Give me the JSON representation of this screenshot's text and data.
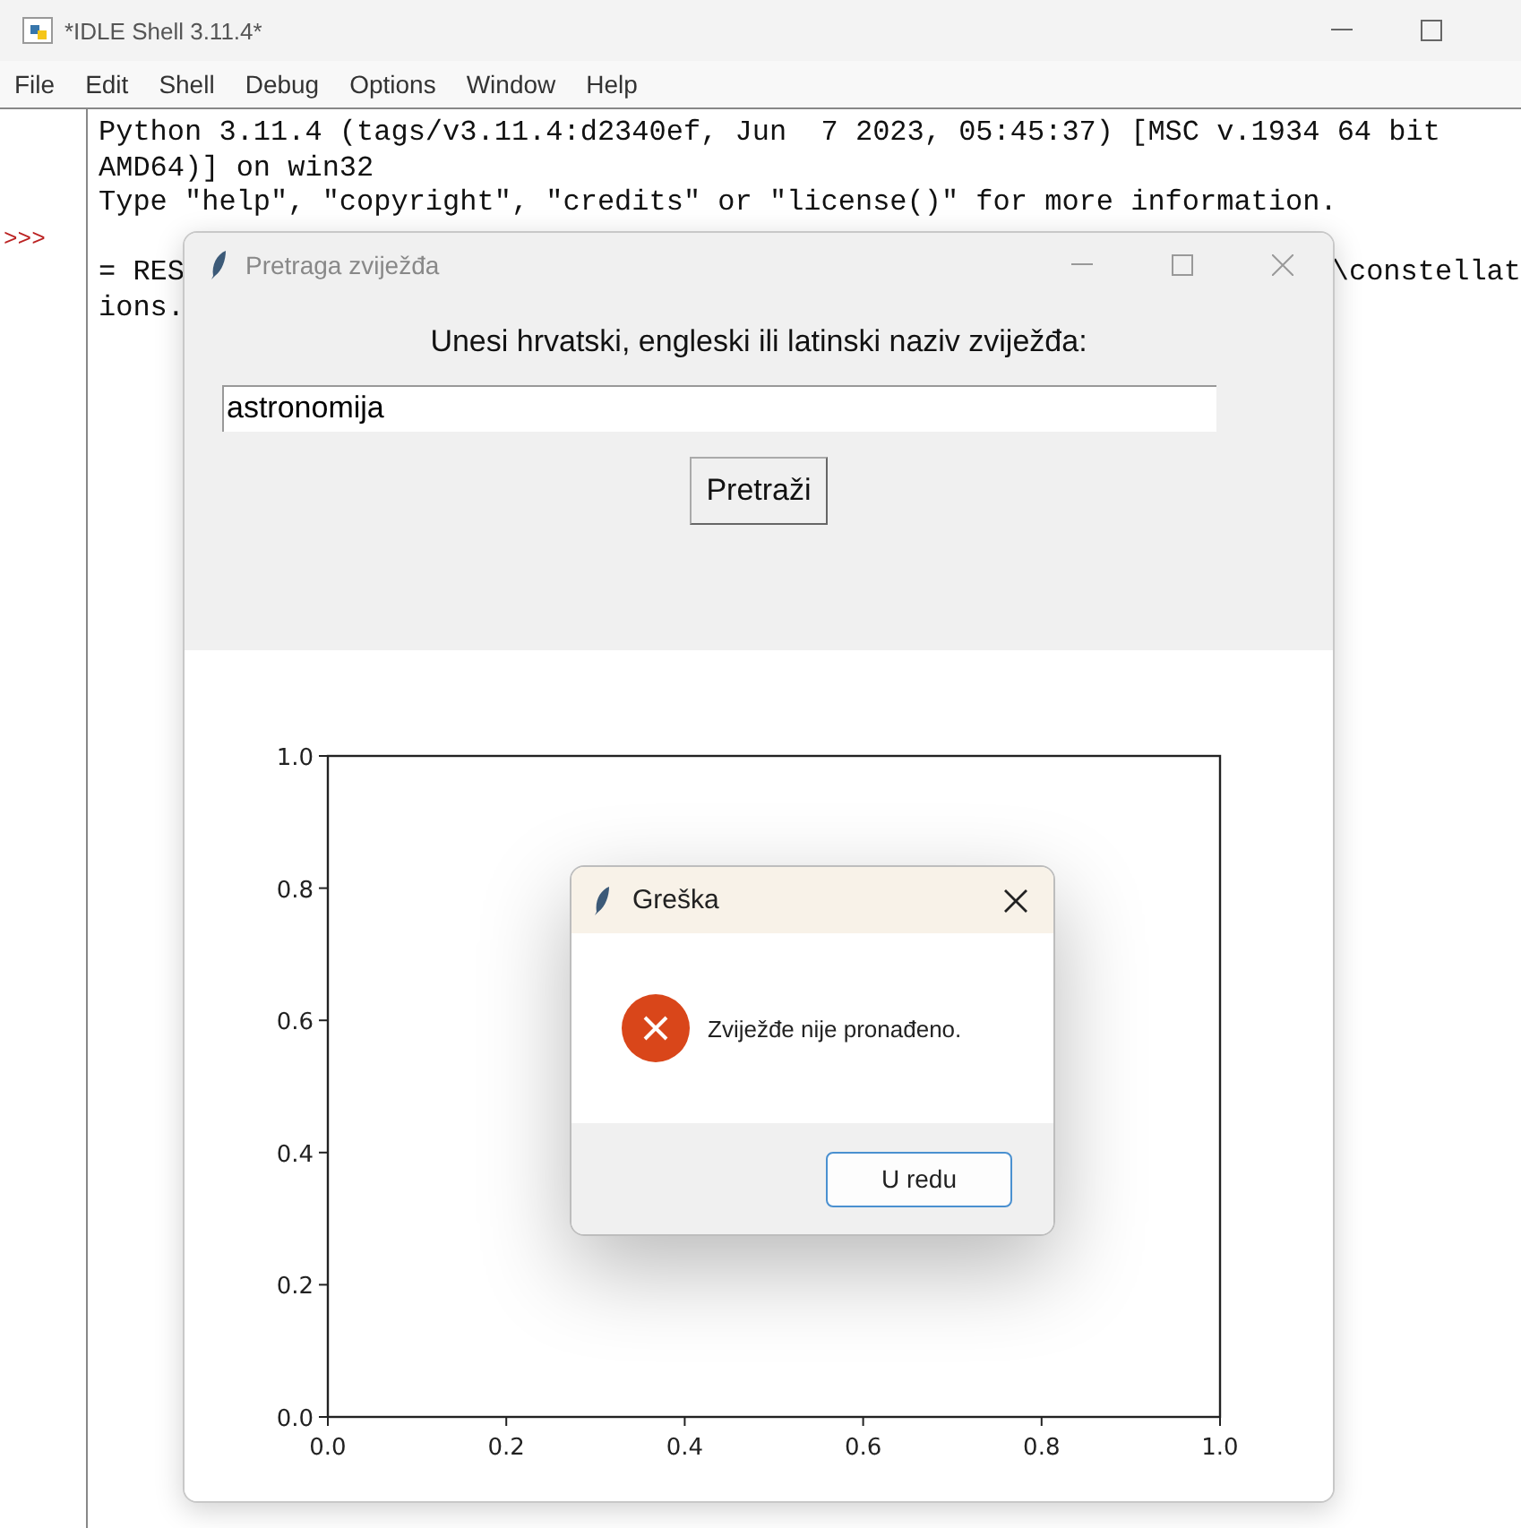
{
  "window": {
    "title": "*IDLE Shell 3.11.4*"
  },
  "menu": [
    "File",
    "Edit",
    "Shell",
    "Debug",
    "Options",
    "Window",
    "Help"
  ],
  "shell": {
    "rows": [
      {
        "text": "Python 3.11.4 (tags/v3.11.4:d2340ef, Jun  7 2023, 05:45:37) [MSC v.1934 64 bit"
      },
      {
        "text": "AMD64)] on win32"
      },
      {
        "text": "Type \"help\", \"copyright\", \"credits\" or \"license()\" for more information."
      },
      {
        "prompt": ">>>"
      },
      {
        "text": "= RES",
        "text_right": "\\constellat"
      },
      {
        "text": "ions."
      }
    ]
  },
  "search_window": {
    "title": "Pretraga zviježđa",
    "prompt": "Unesi hrvatski, engleski ili latinski naziv zviježđa:",
    "entry": {
      "value": "astronomija"
    },
    "button": "Pretraži",
    "chart_data": {
      "type": "line",
      "xlim": [
        0,
        1
      ],
      "ylim": [
        0,
        1
      ],
      "xticks": [
        {
          "value": 0,
          "label": "0.0"
        },
        {
          "value": 0.2,
          "label": "0.2"
        },
        {
          "value": 0.4,
          "label": "0.4"
        },
        {
          "value": 0.6,
          "label": "0.6"
        },
        {
          "value": 0.8,
          "label": "0.8"
        },
        {
          "value": 1,
          "label": "1.0"
        }
      ],
      "yticks": [
        {
          "value": 0,
          "label": "0.0"
        },
        {
          "value": 0.2,
          "label": "0.2"
        },
        {
          "value": 0.4,
          "label": "0.4"
        },
        {
          "value": 0.6,
          "label": "0.6"
        },
        {
          "value": 0.8,
          "label": "0.8"
        },
        {
          "value": 1,
          "label": "1.0"
        }
      ]
    }
  },
  "error_dialog": {
    "title": "Greška",
    "message": "Zviježđe nije pronađeno.",
    "button": "U redu"
  }
}
